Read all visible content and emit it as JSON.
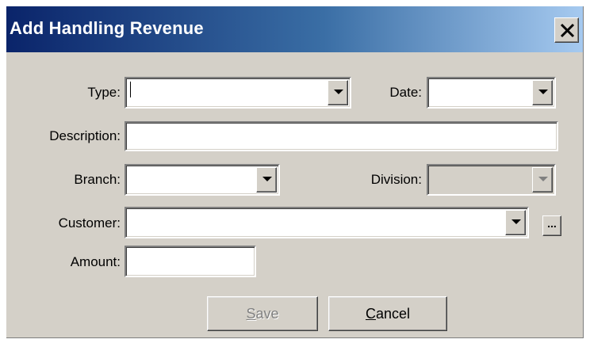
{
  "dialog": {
    "title": "Add Handling Revenue",
    "close_glyph": "✕"
  },
  "form": {
    "type_label": "Type:",
    "type_value": "",
    "date_label": "Date:",
    "date_value": "",
    "description_label": "Description:",
    "description_value": "",
    "branch_label": "Branch:",
    "branch_value": "",
    "division_label": "Division:",
    "division_value": "",
    "customer_label": "Customer:",
    "customer_value": "",
    "customer_lookup_label": "...",
    "amount_label": "Amount:",
    "amount_value": ""
  },
  "buttons": {
    "save_first": "S",
    "save_rest": "ave",
    "cancel_first": "C",
    "cancel_rest": "ancel"
  },
  "state": {
    "save_enabled": false,
    "division_enabled": false
  }
}
